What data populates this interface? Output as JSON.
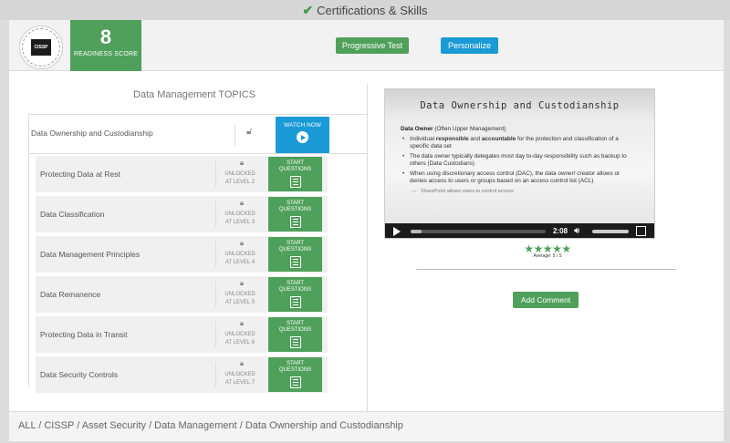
{
  "topbar": {
    "title": "Certifications & Skills",
    "icon": "check-icon"
  },
  "header": {
    "cert_logo": {
      "text": "CISSP",
      "icon": "cissp-logo"
    },
    "readiness": {
      "score": "8",
      "label": "READINESS SCORE"
    },
    "progressive_test_label": "Progressive Test",
    "personalize_label": "Personalize"
  },
  "topics": {
    "title": "Data Management TOPICS",
    "current": {
      "label": "Data Ownership and Custodianship",
      "watch_label": "WATCH NOW"
    },
    "items": [
      {
        "label": "Protecting Data at Rest",
        "status_line1": "UNLOCKED",
        "status_line2": "AT LEVEL 2",
        "button_line1": "START",
        "button_line2": "QUESTIONS"
      },
      {
        "label": "Data Classification",
        "status_line1": "UNLOCKED",
        "status_line2": "AT LEVEL 3",
        "button_line1": "START",
        "button_line2": "QUESTIONS"
      },
      {
        "label": "Data Management Principles",
        "status_line1": "UNLOCKED",
        "status_line2": "AT LEVEL 4",
        "button_line1": "START",
        "button_line2": "QUESTIONS"
      },
      {
        "label": "Data Remanence",
        "status_line1": "UNLOCKED",
        "status_line2": "AT LEVEL 5",
        "button_line1": "START",
        "button_line2": "QUESTIONS"
      },
      {
        "label": "Protecting Data in Transit",
        "status_line1": "UNLOCKED",
        "status_line2": "AT LEVEL 6",
        "button_line1": "START",
        "button_line2": "QUESTIONS"
      },
      {
        "label": "Data Security Controls",
        "status_line1": "UNLOCKED",
        "status_line2": "AT LEVEL 7",
        "button_line1": "START",
        "button_line2": "QUESTIONS"
      }
    ]
  },
  "video": {
    "slide_title": "Data Ownership and Custodianship",
    "heading_bold": "Data Owner",
    "heading_rest": " (Often Upper Management)",
    "bullet1_pre": "Individual ",
    "bullet1_b1": "responsible",
    "bullet1_mid": " and ",
    "bullet1_b2": "accountable",
    "bullet1_post": " for the protection and classification of a specific data set",
    "bullet2": "The data owner typically delegates most day to-day responsibility such as backup to others (Data Custodians)",
    "bullet3": "When using discretionary access control (DAC), the data owner/ creator allows or denies access to users or groups based on an access control list (ACL)",
    "sub_bullet": "SharePoint allows users to control access",
    "time": "2:08",
    "progress_fraction": 0.08,
    "volume_fraction": 1.0
  },
  "rating": {
    "stars": 5,
    "max": 5,
    "average_label": "Average: 5 / 5",
    "star_color": "#4fa05a"
  },
  "comment": {
    "button_label": "Add Comment"
  },
  "breadcrumb": {
    "text": "ALL / CISSP / Asset Security / Data Management / Data Ownership and Custodianship"
  },
  "colors": {
    "green": "#4fa05a",
    "blue": "#1a9ad6"
  }
}
